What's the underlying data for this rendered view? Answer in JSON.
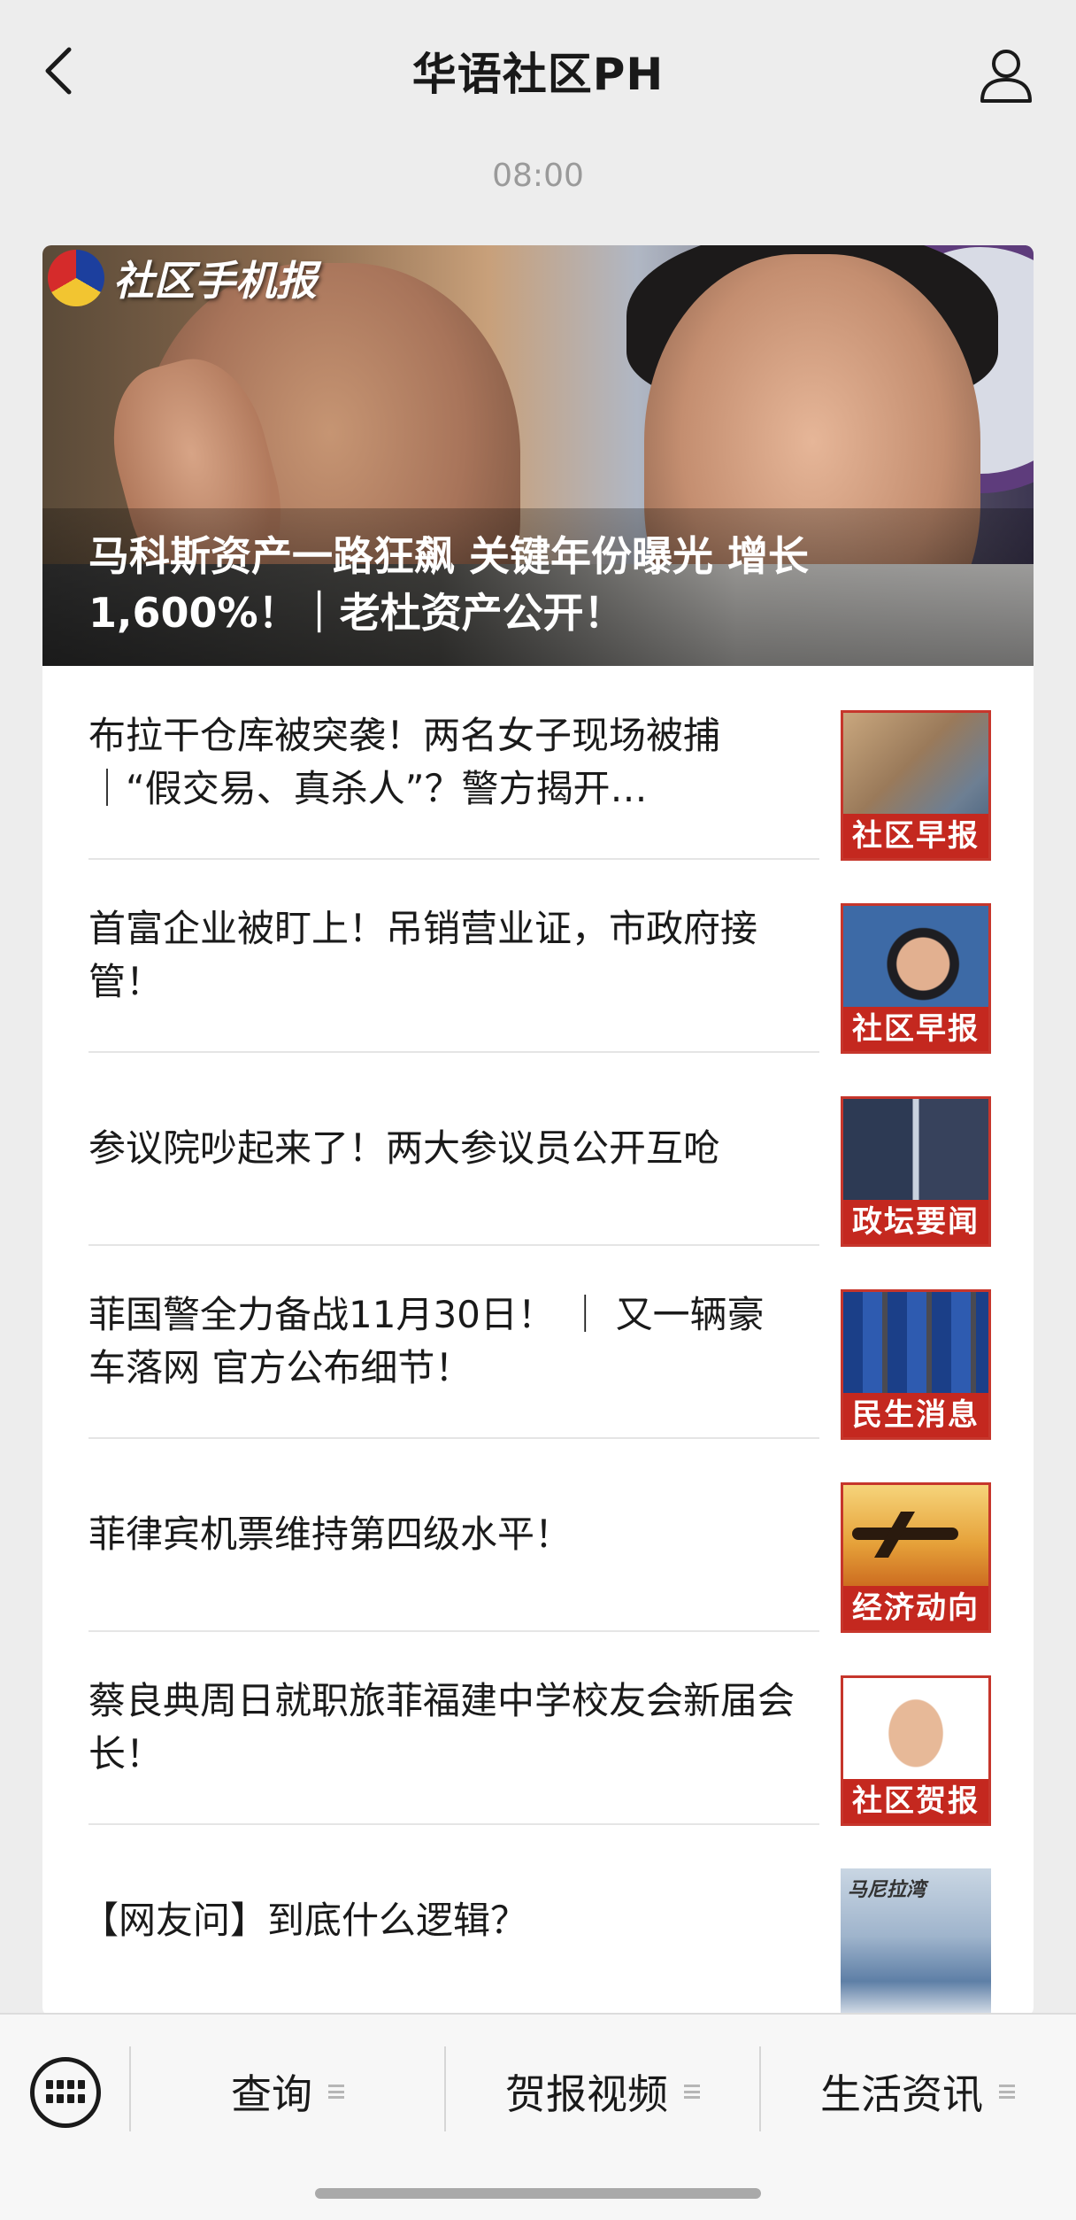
{
  "header": {
    "title": "华语社区PH",
    "back_icon": "back-chevron-icon",
    "user_icon": "user-profile-icon"
  },
  "timestamp": "08:00",
  "hero": {
    "brand": "社区手机报",
    "headline": "马科斯资产一路狂飙 关键年份曝光 增长1,600%！｜老杜资产公开！"
  },
  "articles": [
    {
      "title": "布拉干仓库被突袭！两名女子现场被捕 ｜“假交易、真杀人”？警方揭开…",
      "tag": "社区早报"
    },
    {
      "title": "首富企业被盯上！吊销营业证，市政府接管！",
      "tag": "社区早报"
    },
    {
      "title": "参议院吵起来了！两大参议员公开互呛",
      "tag": "政坛要闻"
    },
    {
      "title": "菲国警全力备战11月30日！ ｜ 又一辆豪车落网 官方公布细节！",
      "tag": "民生消息"
    },
    {
      "title": "菲律宾机票维持第四级水平！",
      "tag": "经济动向"
    },
    {
      "title": "蔡良典周日就职旅菲福建中学校友会新届会长！",
      "tag": "社区贺报"
    },
    {
      "title": "【网友问】到底什么逻辑？",
      "tag": "",
      "thumb_text": "马尼拉湾"
    }
  ],
  "bottom_menu": {
    "keyboard_icon": "keyboard-icon",
    "items": [
      {
        "label": "查询"
      },
      {
        "label": "贺报视频"
      },
      {
        "label": "生活资讯"
      }
    ]
  },
  "colors": {
    "background": "#ededed",
    "card": "#ffffff",
    "tag_red": "#c4281f",
    "text": "#1a1a1a",
    "muted": "#9a9a9a"
  }
}
